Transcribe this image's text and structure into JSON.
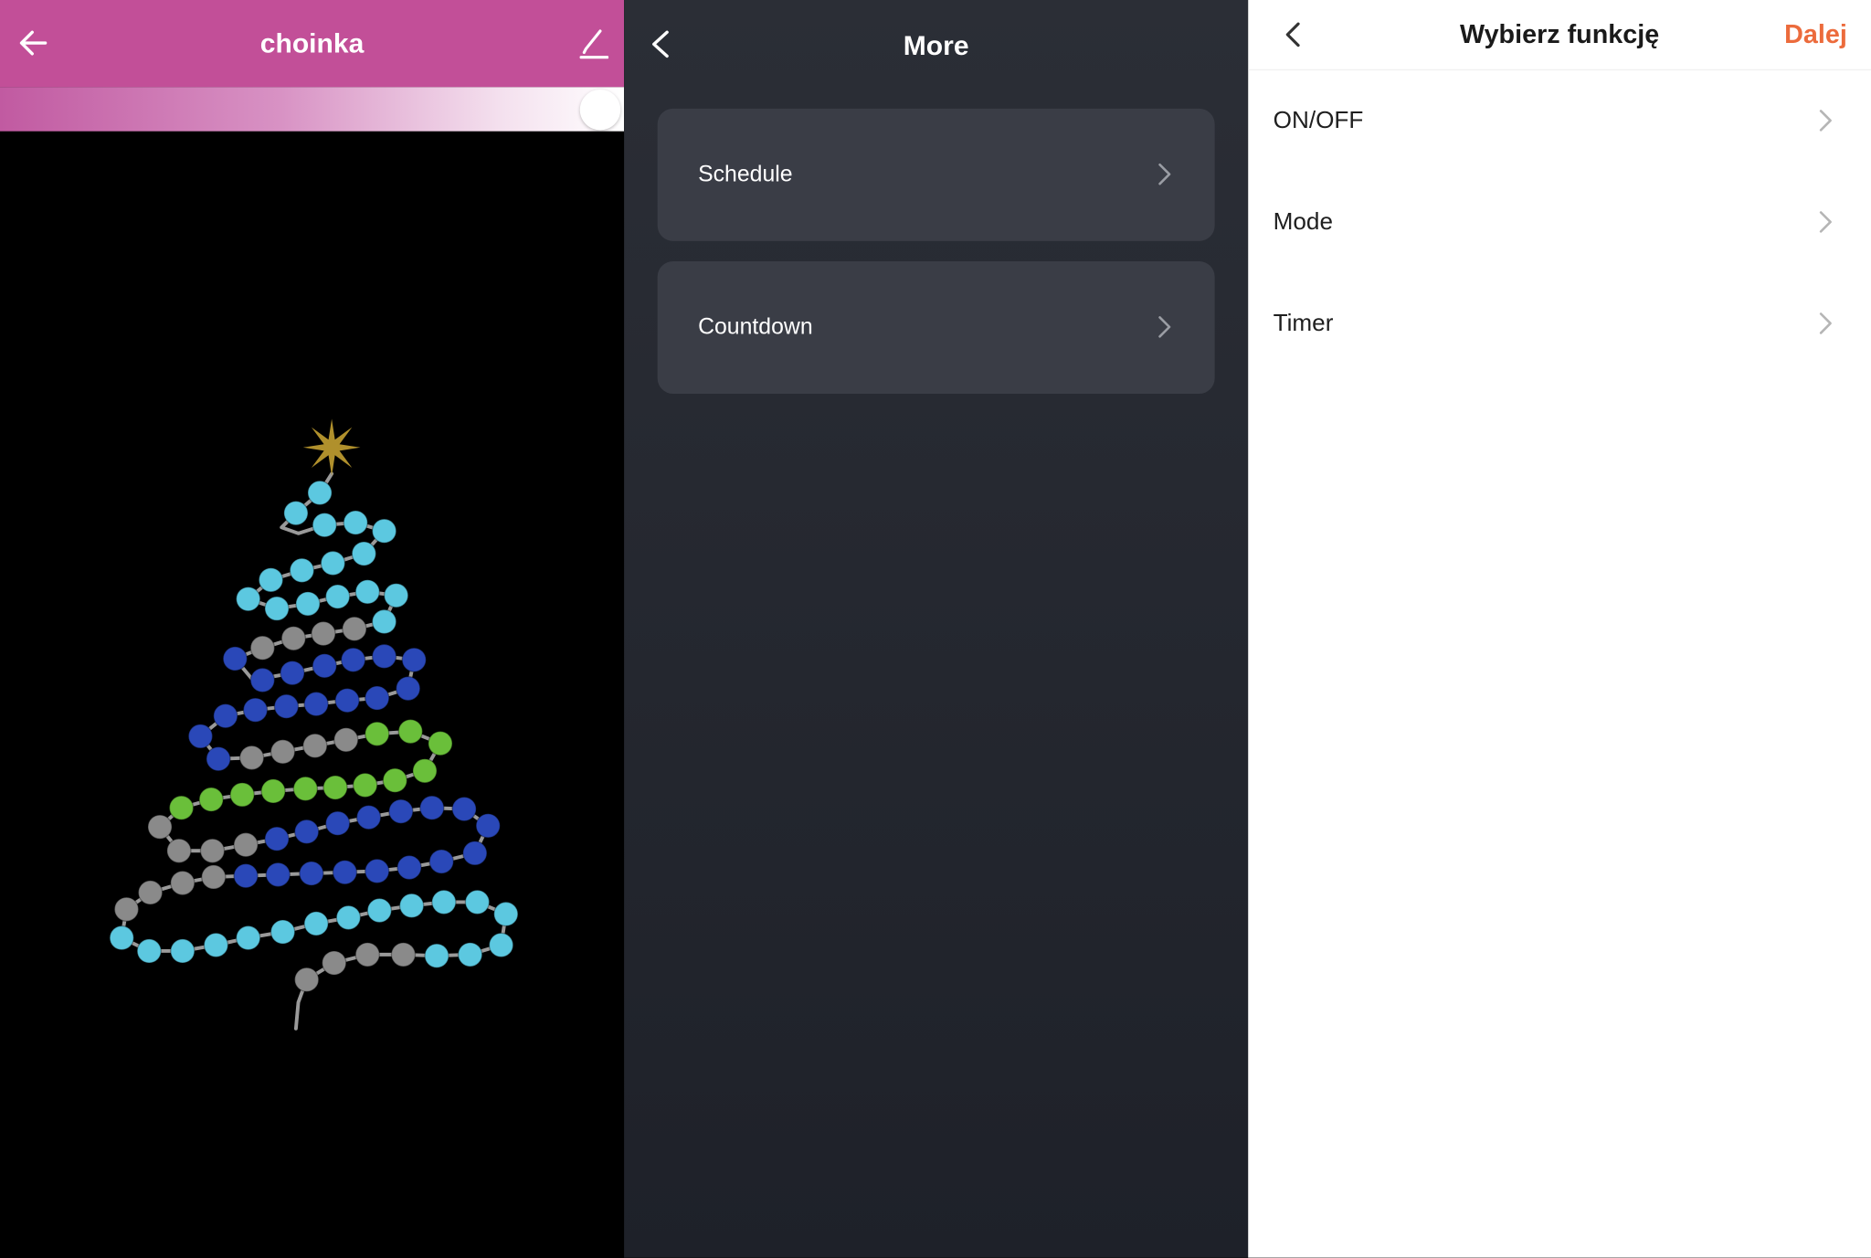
{
  "device_panel": {
    "title": "choinka",
    "back_icon": "arrow-left-icon",
    "edit_icon": "pencil-icon",
    "accent_color": "#c24f98",
    "brightness_level": 1.0,
    "tree": {
      "star_color": "#b0902c",
      "strand_color": "#9a9a9a",
      "bead_colors": {
        "cyan": "#5cc8e0",
        "blue": "#2a48b8",
        "gray": "#8a8a8a",
        "green": "#6abf3a"
      }
    }
  },
  "more_panel": {
    "title": "More",
    "back_icon": "chevron-left-icon",
    "items": [
      {
        "label": "Schedule",
        "icon": "chevron-right-icon"
      },
      {
        "label": "Countdown",
        "icon": "chevron-right-icon"
      }
    ]
  },
  "function_panel": {
    "title": "Wybierz funkcję",
    "next_label": "Dalej",
    "next_color": "#ec6b3c",
    "back_icon": "chevron-left-icon",
    "items": [
      {
        "label": "ON/OFF",
        "icon": "chevron-right-icon"
      },
      {
        "label": "Mode",
        "icon": "chevron-right-icon"
      },
      {
        "label": "Timer",
        "icon": "chevron-right-icon"
      }
    ]
  }
}
